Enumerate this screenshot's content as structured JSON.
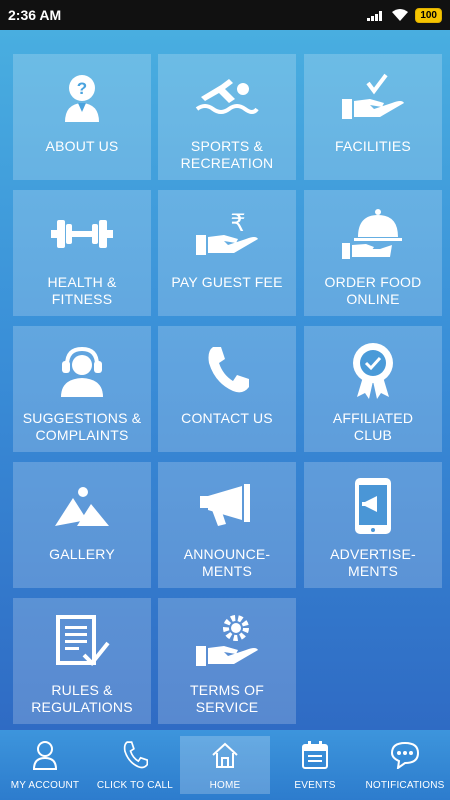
{
  "status": {
    "time": "2:36 AM",
    "battery": "100"
  },
  "tiles": [
    {
      "label": "ABOUT US",
      "icon": "question-person-icon"
    },
    {
      "label": "SPORTS &\nRECREATION",
      "icon": "swimmer-icon"
    },
    {
      "label": "FACILITIES",
      "icon": "hand-check-icon"
    },
    {
      "label": "HEALTH &\nFITNESS",
      "icon": "dumbbell-icon"
    },
    {
      "label": "PAY GUEST FEE",
      "icon": "hand-rupee-icon"
    },
    {
      "label": "ORDER FOOD\nONLINE",
      "icon": "food-cloche-icon"
    },
    {
      "label": "SUGGESTIONS &\nCOMPLAINTS",
      "icon": "headset-person-icon"
    },
    {
      "label": "CONTACT US",
      "icon": "phone-icon"
    },
    {
      "label": "AFFILIATED\nCLUB",
      "icon": "badge-icon"
    },
    {
      "label": "GALLERY",
      "icon": "mountain-sun-icon"
    },
    {
      "label": "ANNOUNCE-\nMENTS",
      "icon": "megaphone-icon"
    },
    {
      "label": "ADVERTISE-\nMENTS",
      "icon": "phone-megaphone-icon"
    },
    {
      "label": "RULES &\nREGULATIONS",
      "icon": "document-check-icon"
    },
    {
      "label": "TERMS OF\nSERVICE",
      "icon": "hand-gear-icon"
    }
  ],
  "tabbar": {
    "items": [
      {
        "label": "MY ACCOUNT",
        "icon": "user-icon"
      },
      {
        "label": "CLICK TO CALL",
        "icon": "phone-icon"
      },
      {
        "label": "HOME",
        "icon": "home-icon"
      },
      {
        "label": "EVENTS",
        "icon": "calendar-icon"
      },
      {
        "label": "NOTIFICATIONS",
        "icon": "chat-bubble-icon"
      }
    ],
    "active_index": 2
  }
}
